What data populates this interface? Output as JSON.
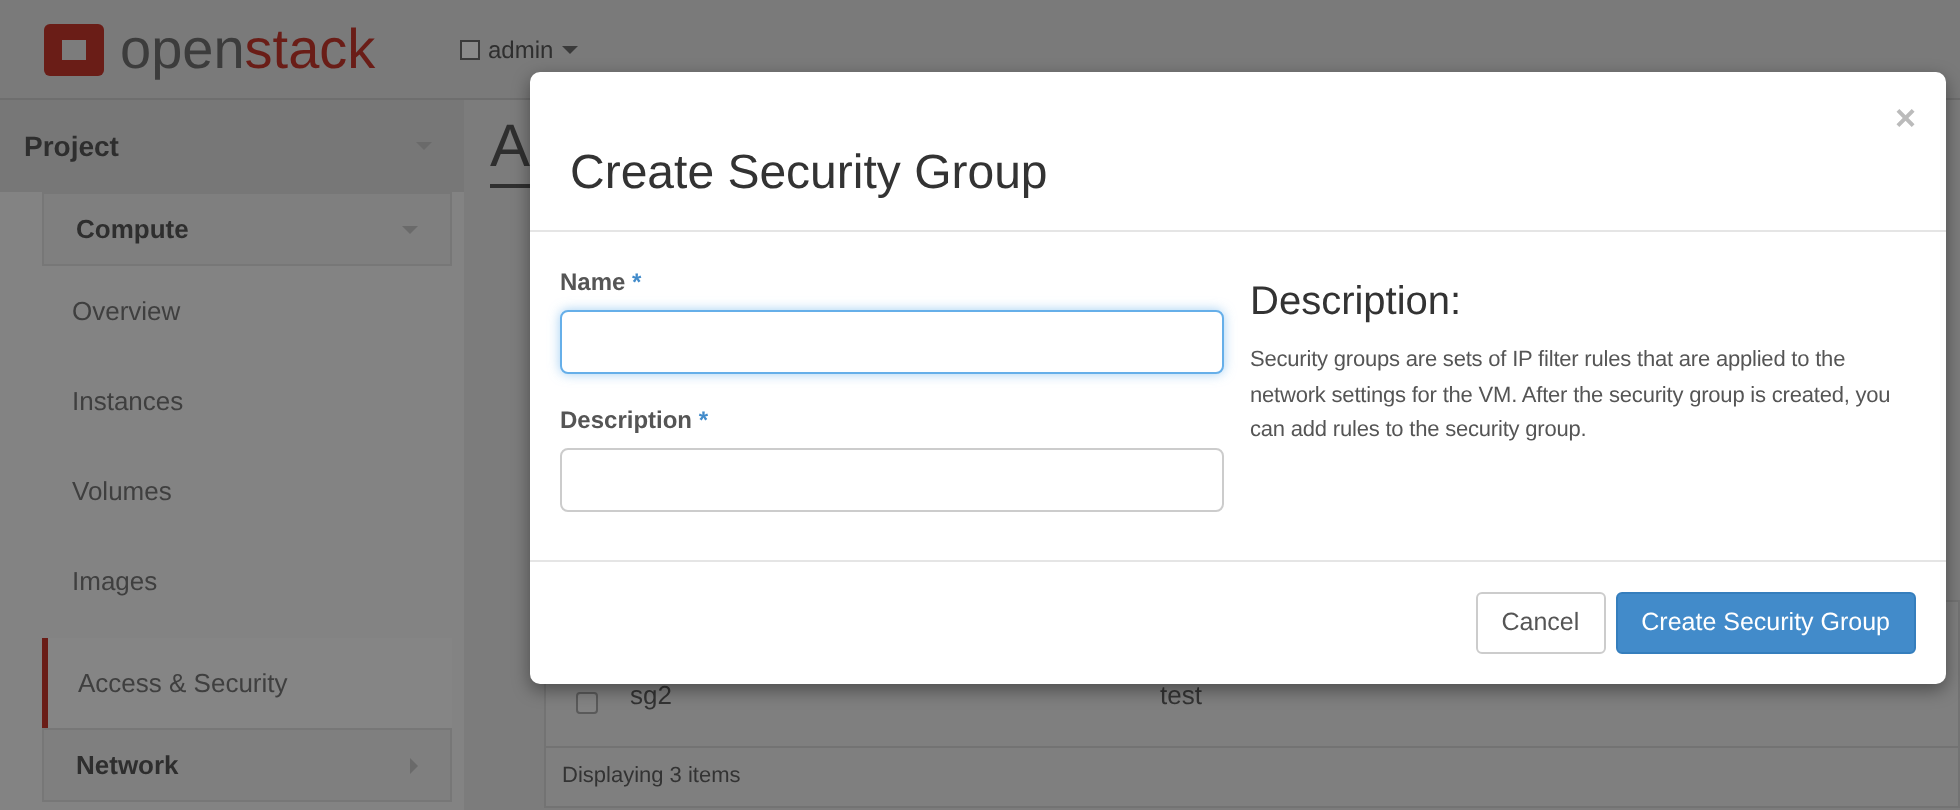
{
  "topbar": {
    "brand_light": "open",
    "brand_accent": "stack",
    "project_menu": "admin"
  },
  "sidebar": {
    "panel": "Project",
    "panel_expanded": true,
    "groups": [
      {
        "label": "Compute",
        "expanded": true,
        "items": [
          {
            "label": "Overview",
            "selected": false
          },
          {
            "label": "Instances",
            "selected": false
          },
          {
            "label": "Volumes",
            "selected": false
          },
          {
            "label": "Images",
            "selected": false
          },
          {
            "label": "Access & Security",
            "selected": true
          }
        ]
      },
      {
        "label": "Network",
        "expanded": false
      }
    ]
  },
  "page": {
    "heading": "A",
    "rows": [
      {
        "checked": false,
        "name": "sg2",
        "description": "test"
      }
    ],
    "footer": "Displaying 3 items"
  },
  "modal": {
    "title": "Create Security Group",
    "close": "×",
    "fields": [
      {
        "label": "Name",
        "required_mark": "*",
        "focused": true
      },
      {
        "label": "Description",
        "required_mark": "*",
        "focused": false
      }
    ],
    "help": {
      "heading": "Description:",
      "text": "Security groups are sets of IP filter rules that are applied to the network settings for the VM. After the security group is created, you can add rules to the security group."
    },
    "buttons": [
      {
        "label": "Cancel",
        "kind": "default"
      },
      {
        "label": "Create Security Group",
        "kind": "primary"
      }
    ]
  }
}
